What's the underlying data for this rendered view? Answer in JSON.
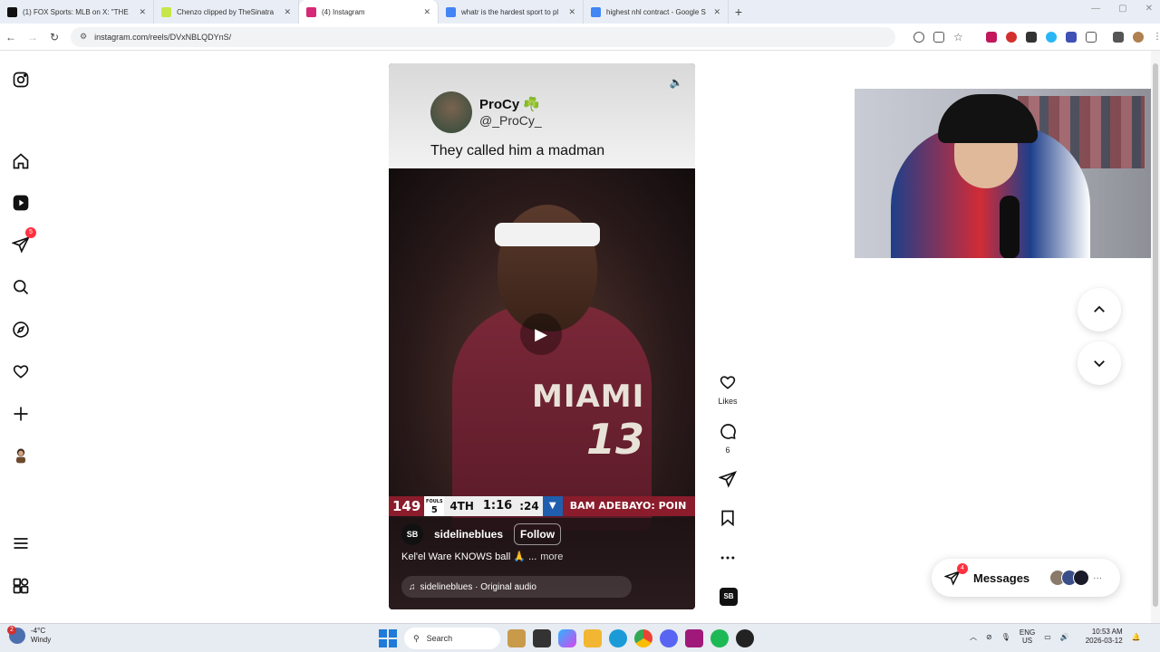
{
  "browser": {
    "tabs": [
      {
        "label": "(1) FOX Sports: MLB on X: \"THE",
        "color": "#111111",
        "active": false
      },
      {
        "label": "Chenzo clipped by TheSinatra",
        "color": "#c7e64a",
        "active": false
      },
      {
        "label": "(4) Instagram",
        "color": "#d62976",
        "active": true
      },
      {
        "label": "whatr is the hardest sport to pl",
        "color": "#4285f4",
        "active": false
      },
      {
        "label": "highest nhl contract - Google S",
        "color": "#4285f4",
        "active": false
      }
    ],
    "new_tab": "+",
    "url": "instagram.com/reels/DVxNBLQDYnS/"
  },
  "sidebar": {
    "notification_count": "5"
  },
  "post": {
    "name": "ProCy ☘️",
    "handle": "@_ProCy_",
    "caption": "They called him a madman"
  },
  "video": {
    "jersey_city": "MIAMI",
    "jersey_number": "13",
    "scorebug": {
      "score": "149",
      "fouls_label": "FOULS",
      "fouls": "5",
      "period": "4TH",
      "clock": "1:16",
      "shot_clock": ":24",
      "player_text": "BAM ADEBAYO: POIN"
    }
  },
  "reel": {
    "author": "sidelineblues",
    "author_badge": "SB",
    "follow_label": "Follow",
    "caption": "Kel'el Ware KNOWS ball 🙏 ...",
    "more_label": "more",
    "audio": "sidelineblues · Original audio"
  },
  "actions": {
    "likes_label": "Likes",
    "comments_count": "6",
    "audio_badge": "SB"
  },
  "messages": {
    "label": "Messages",
    "badge": "4",
    "more": "···"
  },
  "taskbar": {
    "weather_badge": "2",
    "temperature": "-4°C",
    "condition": "Windy",
    "search_placeholder": "Search",
    "lang_top": "ENG",
    "lang_bottom": "US",
    "time": "10:53 AM",
    "date": "2026-03-12"
  }
}
